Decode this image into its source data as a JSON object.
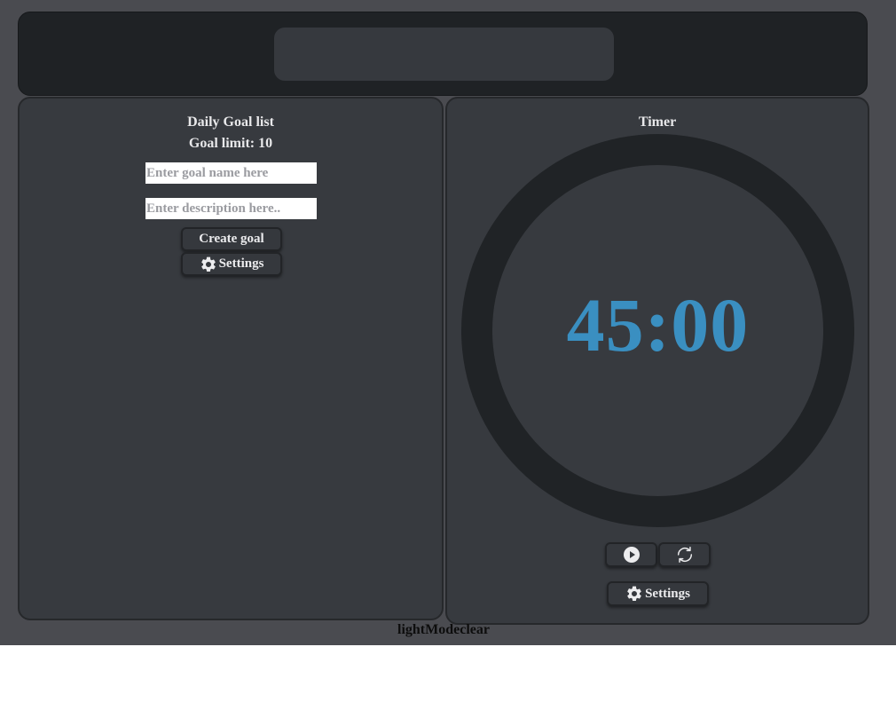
{
  "goals": {
    "title": "Daily Goal list",
    "limit_text": "Goal limit: 10",
    "name_placeholder": "Enter goal name here",
    "description_placeholder": "Enter description here..",
    "create_label": "Create goal",
    "settings_label": "Settings"
  },
  "timer": {
    "title": "Timer",
    "display": "45:00",
    "play_icon": "play-icon",
    "reset_icon": "refresh-icon",
    "settings_label": "Settings"
  },
  "footer": {
    "text": "lightModeclear"
  },
  "colors": {
    "background": "#4a4b50",
    "panel": "#373a3f",
    "header": "#1f2225",
    "ring": "#202326",
    "timer_text": "#3a8fc1"
  }
}
